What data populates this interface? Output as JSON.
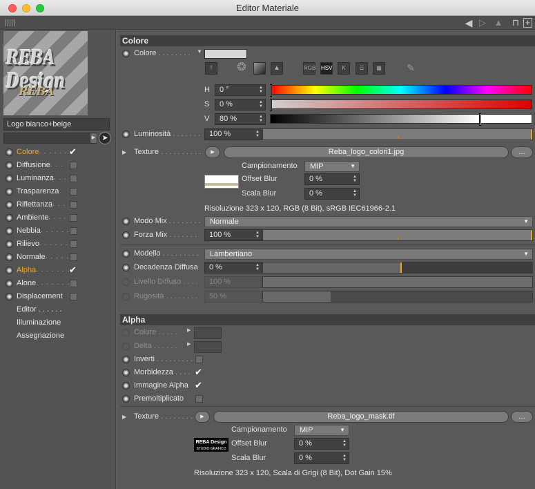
{
  "window": {
    "title": "Editor Materiale"
  },
  "toolbar": {
    "back_icon": "arrow-left-icon",
    "forward_icon": "arrow-right-icon",
    "lock_icon": "lock-icon",
    "new_icon": "plus-icon"
  },
  "left": {
    "preview_logo_text": "REBA Design",
    "preview_logo_subtext": "REBA",
    "material_name": "Logo bianco+beige",
    "channels": [
      {
        "label": "Colore",
        "dots": " . . . . . .",
        "state": "checked",
        "active": true
      },
      {
        "label": "Diffusione",
        "dots": " . . .",
        "state": "unchecked",
        "active": false
      },
      {
        "label": "Luminanza",
        "dots": " . . .",
        "state": "unchecked",
        "active": false
      },
      {
        "label": "Trasparenza",
        "dots": "",
        "state": "unchecked",
        "active": false
      },
      {
        "label": "Riflettanza",
        "dots": " . . .",
        "state": "unchecked",
        "active": false
      },
      {
        "label": "Ambiente",
        "dots": " . . . .",
        "state": "unchecked",
        "active": false
      },
      {
        "label": "Nebbia",
        "dots": " . . . . . .",
        "state": "unchecked",
        "active": false
      },
      {
        "label": "Rilievo",
        "dots": " . . . . . .",
        "state": "unchecked",
        "active": false
      },
      {
        "label": "Normale",
        "dots": " . . . . .",
        "state": "unchecked",
        "active": false
      },
      {
        "label": "Alpha",
        "dots": " . . . . . . .",
        "state": "checked",
        "active": true
      },
      {
        "label": "Alone",
        "dots": " . . . . . . .",
        "state": "unchecked",
        "active": false
      },
      {
        "label": "Displacement",
        "dots": "",
        "state": "unchecked",
        "active": false
      }
    ],
    "extra": [
      "Editor . . . . . .",
      "Illuminazione",
      "Assegnazione"
    ]
  },
  "colore": {
    "section": "Colore",
    "colore_label": "Colore",
    "colore_dots": " . . . . . . . .",
    "swatch_color": "#d7d7d7",
    "icons": [
      "eyedropper-icon",
      "color-wheel-icon",
      "spectrum-icon",
      "picture-icon",
      "rgb-icon",
      "hsv-icon",
      "kelvin-icon",
      "sliders-icon",
      "swatches-icon",
      "picker-icon"
    ],
    "icon_labels": [
      "RGB",
      "HSV",
      "K"
    ],
    "h_label": "H",
    "h_value": "0 °",
    "s_label": "S",
    "s_value": "0 %",
    "v_label": "V",
    "v_value": "80 %",
    "v_level": 0.8,
    "lum_label": "Luminosità",
    "lum_dots": " . . . . . . .",
    "lum_value": "100 %",
    "texture_label": "Texture",
    "texture_dots": " . . . . . . . . . .",
    "texture_file": "Reba_logo_colori1.jpg",
    "ellipsis": "...",
    "camp_label": "Campionamento",
    "camp_value": "MIP",
    "offset_label": "Offset Blur",
    "offset_value": "0 %",
    "scala_label": "Scala Blur",
    "scala_value": "0 %",
    "res_info": "Risoluzione 323 x 120, RGB (8 Bit), sRGB IEC61966-2.1",
    "modo_label": "Modo Mix",
    "modo_dots": " . . . . . . . .",
    "modo_value": "Normale",
    "forza_label": "Forza Mix",
    "forza_dots": " . . . . . . .",
    "forza_value": "100 %",
    "modello_label": "Modello",
    "modello_dots": " . . . . . . . . .",
    "modello_value": "Lambertiano",
    "decad_label": "Decadenza Diffusa",
    "decad_value": "0 %",
    "decad_level": 0.51,
    "livello_label": "Livello Diffuso",
    "livello_dots": " . . . .",
    "livello_value": "100 %",
    "rugo_label": "Rugosità",
    "rugo_dots": " . . . . . . . .",
    "rugo_value": "50 %",
    "rugo_level": 0.25
  },
  "alpha": {
    "section": "Alpha",
    "colore_label": "Colore",
    "colore_dots": " . . . . .",
    "delta_label": "Delta",
    "delta_dots": " . . . . . .",
    "inverti_label": "Inverti",
    "inverti_dots": " . . . . . . . . .",
    "morb_label": "Morbidezza",
    "morb_dots": " . . . .",
    "imm_label": "Immagine Alpha",
    "premolt_label": "Premoltiplicato",
    "texture_label": "Texture",
    "texture_dots": " . . . . . . . . . .",
    "texture_file": "Reba_logo_mask.tif",
    "ellipsis": "...",
    "camp_label": "Campionamento",
    "camp_value": "MIP",
    "offset_label": "Offset Blur",
    "offset_value": "0 %",
    "scala_label": "Scala Blur",
    "scala_value": "0 %",
    "thumb_text": "REBA Design",
    "thumb_subtext": "STUDIO GRAFICO",
    "res_info": "Risoluzione 323 x 120, Scala di Grigi (8 Bit), Dot Gain 15%"
  }
}
